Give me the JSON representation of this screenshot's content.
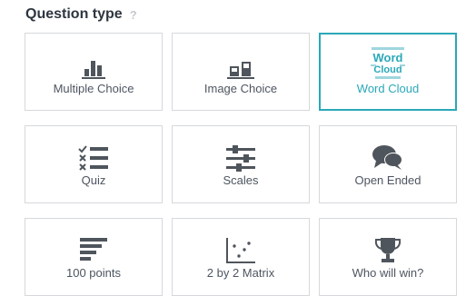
{
  "header": {
    "title": "Question type",
    "help": "?"
  },
  "tiles": [
    {
      "label": "Multiple Choice",
      "icon": "bar-chart-icon",
      "selected": false
    },
    {
      "label": "Image Choice",
      "icon": "image-choice-icon",
      "selected": false
    },
    {
      "label": "Word Cloud",
      "icon": "word-cloud-icon",
      "selected": true,
      "icon_text": {
        "line1": "Word",
        "line2": "Cloud"
      }
    },
    {
      "label": "Quiz",
      "icon": "quiz-checklist-icon",
      "selected": false
    },
    {
      "label": "Scales",
      "icon": "sliders-icon",
      "selected": false
    },
    {
      "label": "Open Ended",
      "icon": "chat-bubbles-icon",
      "selected": false
    },
    {
      "label": "100 points",
      "icon": "horizontal-bars-icon",
      "selected": false
    },
    {
      "label": "2 by 2 Matrix",
      "icon": "scatter-matrix-icon",
      "selected": false
    },
    {
      "label": "Who will win?",
      "icon": "trophy-icon",
      "selected": false
    }
  ],
  "colors": {
    "accent": "#2aa8b8",
    "icon": "#4f555c",
    "border": "#d6d8db",
    "text": "#4e5560",
    "title": "#2e3640"
  }
}
